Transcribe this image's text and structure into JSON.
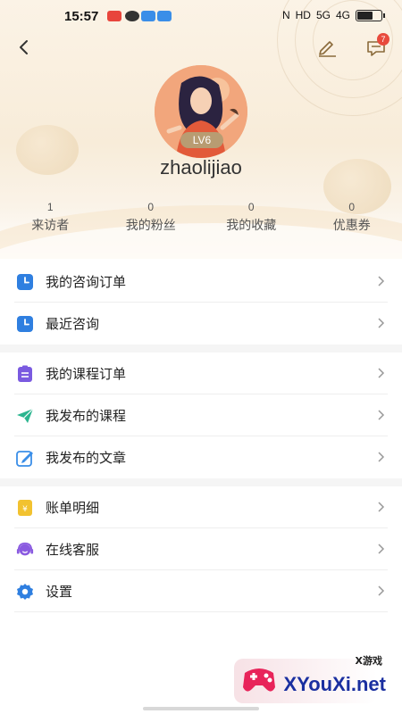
{
  "status_bar": {
    "time": "15:57",
    "network": "HD",
    "signal": "5G",
    "signal2": "4G"
  },
  "header": {
    "back_icon": "back-chevron-icon",
    "edit_icon": "edit-pencil-icon",
    "message_icon": "message-icon",
    "message_badge": "7"
  },
  "profile": {
    "level": "LV6",
    "username": "zhaolijiao"
  },
  "stats": [
    {
      "value": "1",
      "label": "来访者"
    },
    {
      "value": "0",
      "label": "我的粉丝"
    },
    {
      "value": "0",
      "label": "我的收藏"
    },
    {
      "value": "0",
      "label": "优惠券"
    }
  ],
  "menu_groups": [
    {
      "items": [
        {
          "label": "我的咨询订单",
          "icon": "clock-icon",
          "color": "#2f7fe0"
        },
        {
          "label": "最近咨询",
          "icon": "clock-icon",
          "color": "#2f7fe0"
        }
      ]
    },
    {
      "items": [
        {
          "label": "我的课程订单",
          "icon": "clipboard-icon",
          "color": "#7a5ae0"
        },
        {
          "label": "我发布的课程",
          "icon": "paper-plane-icon",
          "color": "#2bb58f"
        },
        {
          "label": "我发布的文章",
          "icon": "pen-icon",
          "color": "#3a8ee8"
        }
      ]
    },
    {
      "items": [
        {
          "label": "账单明细",
          "icon": "bill-icon",
          "color": "#f2c230"
        },
        {
          "label": "在线客服",
          "icon": "headset-icon",
          "color": "#8a5ae0"
        },
        {
          "label": "设置",
          "icon": "gear-icon",
          "color": "#2f7fe0"
        }
      ]
    }
  ],
  "watermark": {
    "brand": "XYouXi.net",
    "small": "X游戏"
  },
  "colors": {
    "accent_gold": "#b89c72",
    "badge_red": "#e84a3c",
    "header_bg": "#f8ecd9"
  }
}
